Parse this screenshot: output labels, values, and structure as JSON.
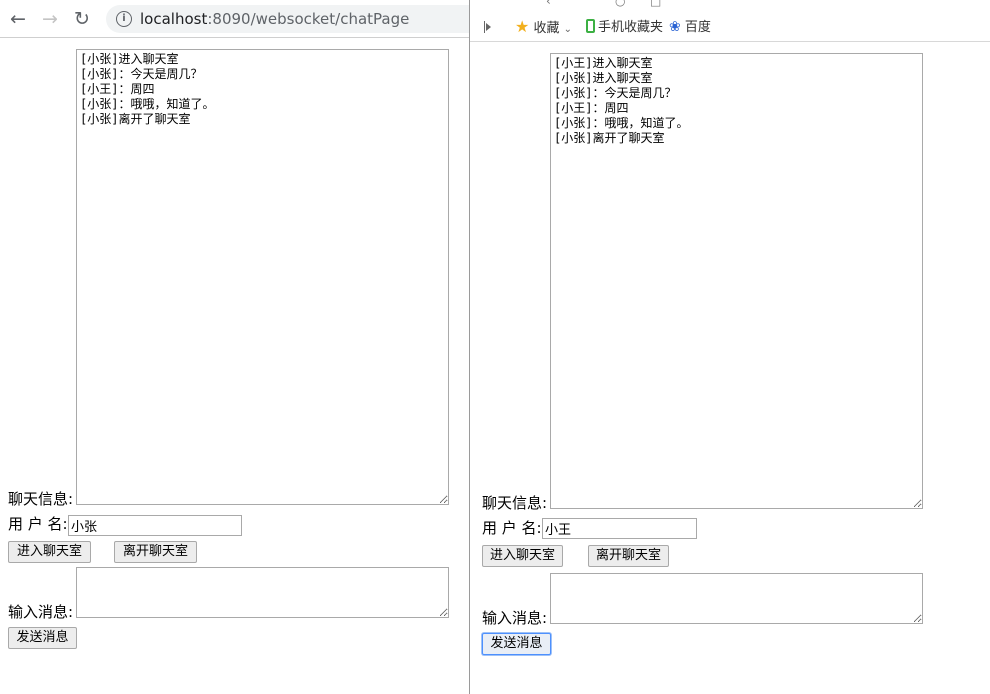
{
  "left": {
    "nav": {
      "back": "←",
      "forward": "→",
      "reload": "↻"
    },
    "url": {
      "host": "localhost",
      "rest": ":8090/websocket/chatPage"
    },
    "chat_label": "聊天信息:",
    "chat_text": "[小张]进入聊天室\n[小张]：今天是周几？\n[小王]：周四\n[小张]：哦哦，知道了。\n[小张]离开了聊天室",
    "username_label": "用 户 名:",
    "username_value": "小张",
    "enter_button": "进入聊天室",
    "leave_button": "离开聊天室",
    "message_label": "输入消息:",
    "message_value": "",
    "send_button": "发送消息"
  },
  "right": {
    "bookmarks": [
      {
        "label": "收藏",
        "icon": "star-icon"
      },
      {
        "label": "手机收藏夹",
        "icon": "phone-icon"
      },
      {
        "label": "百度",
        "icon": "paw-icon"
      }
    ],
    "chat_label": "聊天信息:",
    "chat_text": "[小王]进入聊天室\n[小张]进入聊天室\n[小张]：今天是周几？\n[小王]：周四\n[小张]：哦哦，知道了。\n[小张]离开了聊天室",
    "username_label": "用 户 名:",
    "username_value": "小王",
    "enter_button": "进入聊天室",
    "leave_button": "离开聊天室",
    "message_label": "输入消息:",
    "message_value": "",
    "send_button": "发送消息"
  }
}
